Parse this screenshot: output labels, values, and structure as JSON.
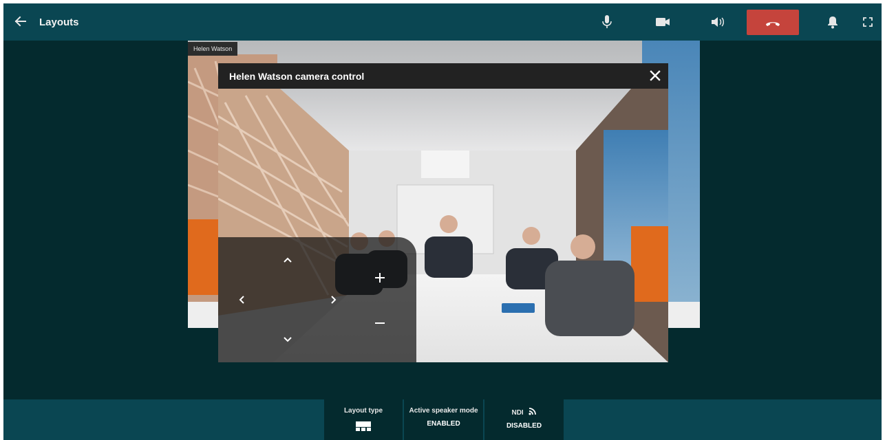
{
  "header": {
    "title": "Layouts",
    "back_icon": "arrow-left-icon",
    "toolbar_icons": [
      "microphone-icon",
      "video-camera-icon",
      "speaker-icon",
      "hang-up-icon",
      "bell-icon",
      "fullscreen-icon"
    ],
    "hangup_color": "#c5443c"
  },
  "video": {
    "participant_name": "Helen Watson"
  },
  "camera_dialog": {
    "title": "Helen Watson camera control",
    "controls": [
      "chevron-up-icon",
      "chevron-left-icon",
      "chevron-right-icon",
      "chevron-down-icon",
      "zoom-in-icon",
      "zoom-out-icon"
    ]
  },
  "bottom_bar": {
    "layout_type": {
      "label": "Layout type",
      "icon": "layout-grid-icon"
    },
    "active_speaker": {
      "label": "Active speaker mode",
      "value": "ENABLED"
    },
    "ndi": {
      "label": "NDI",
      "icon": "rss-feed-icon",
      "value": "DISABLED"
    }
  },
  "colors": {
    "bar": "#0a4652",
    "background": "#042a2e",
    "accent_red": "#c5443c"
  }
}
